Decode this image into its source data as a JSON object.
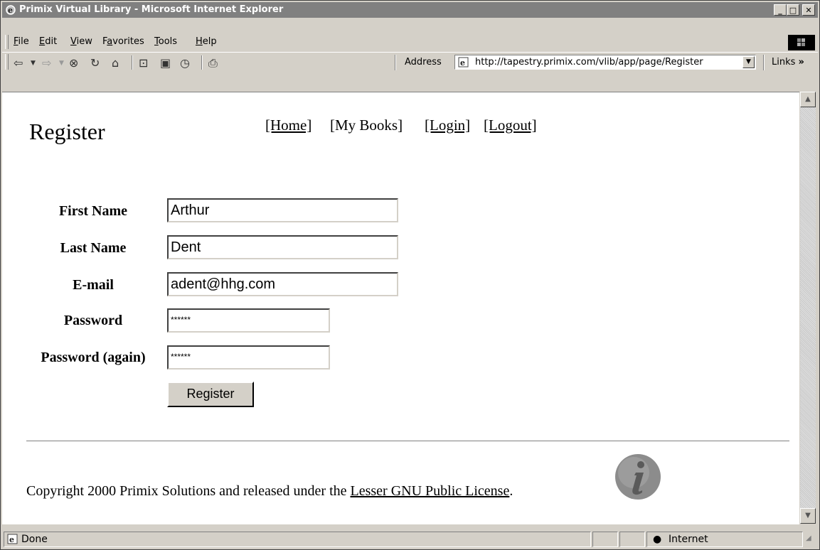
{
  "window": {
    "title": "Primix Virtual Library - Microsoft Internet Explorer"
  },
  "menu": [
    {
      "label": "File",
      "key": "F",
      "rest": "ile"
    },
    {
      "label": "Edit",
      "key": "E",
      "rest": "dit"
    },
    {
      "label": "View",
      "key": "V",
      "rest": "iew"
    },
    {
      "label": "Favorites",
      "pre": "F",
      "key": "a",
      "rest": "vorites"
    },
    {
      "label": "Tools",
      "key": "T",
      "rest": "ools"
    },
    {
      "label": "Help",
      "key": "H",
      "rest": "elp"
    }
  ],
  "toolbar": {
    "address_label": "Address",
    "address_url": "http://tapestry.primix.com/vlib/app/page/Register",
    "links_label": "Links"
  },
  "page": {
    "title": "Register",
    "nav": [
      "[Home]",
      "[My Books]",
      "[Login]",
      "[Logout]"
    ],
    "form": {
      "first_name_label": "First Name",
      "first_name_value": "Arthur",
      "last_name_label": "Last Name",
      "last_name_value": "Dent",
      "email_label": "E-mail",
      "email_value": "adent@hhg.com",
      "password_label": "Password",
      "password_value": "******",
      "password_again_label": "Password (again)",
      "password_again_value": "******",
      "submit_label": "Register"
    },
    "footer": {
      "copyright_text": "Copyright 2000 Primix Solutions and released under the ",
      "license_link": "Lesser GNU Public License",
      "period": "."
    }
  },
  "statusbar": {
    "text": "Done",
    "zone": "Internet"
  }
}
